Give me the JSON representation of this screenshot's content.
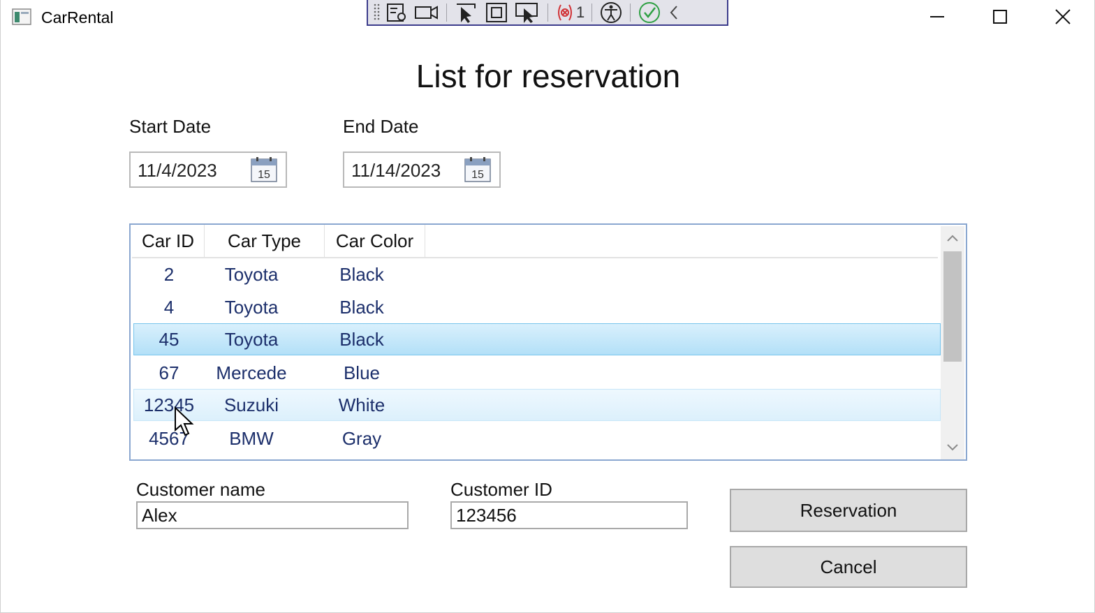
{
  "window": {
    "title": "CarRental"
  },
  "debug_toolbar": {
    "binding_failures": "1",
    "icons": [
      "grip-icon",
      "select-element-icon",
      "record-icon",
      "pointer-select-icon",
      "display-layout-adorners-icon",
      "track-focus-icon",
      "binding-failures-icon",
      "accessibility-icon",
      "hot-reload-ok-icon",
      "collapse-toolbar-icon"
    ]
  },
  "page": {
    "title": "List for reservation"
  },
  "dates": {
    "start_label": "Start Date",
    "start_value": "11/4/2023",
    "end_label": "End Date",
    "end_value": "11/14/2023",
    "calendar_day": "15"
  },
  "cars": {
    "columns": [
      "Car ID",
      "Car Type",
      "Car Color"
    ],
    "rows": [
      {
        "id": "2",
        "type": "Toyota",
        "color": "Black",
        "state": "normal"
      },
      {
        "id": "4",
        "type": "Toyota",
        "color": "Black",
        "state": "normal"
      },
      {
        "id": "45",
        "type": "Toyota",
        "color": "Black",
        "state": "selected"
      },
      {
        "id": "67",
        "type": "Mercede",
        "color": "Blue",
        "state": "normal"
      },
      {
        "id": "12345",
        "type": "Suzuki",
        "color": "White",
        "state": "hover"
      },
      {
        "id": "4567",
        "type": "BMW",
        "color": "Gray",
        "state": "normal"
      }
    ]
  },
  "customer": {
    "name_label": "Customer name",
    "name_value": "Alex",
    "id_label": "Customer ID",
    "id_value": "123456"
  },
  "actions": {
    "reservation_label": "Reservation",
    "cancel_label": "Cancel"
  },
  "colors": {
    "selected_row": "#b3e0f8",
    "row_text": "#1c2f6b",
    "toolbar_border": "#3c3c8c",
    "hot_reload_ok": "#2ea043",
    "binding_error": "#d13438"
  }
}
